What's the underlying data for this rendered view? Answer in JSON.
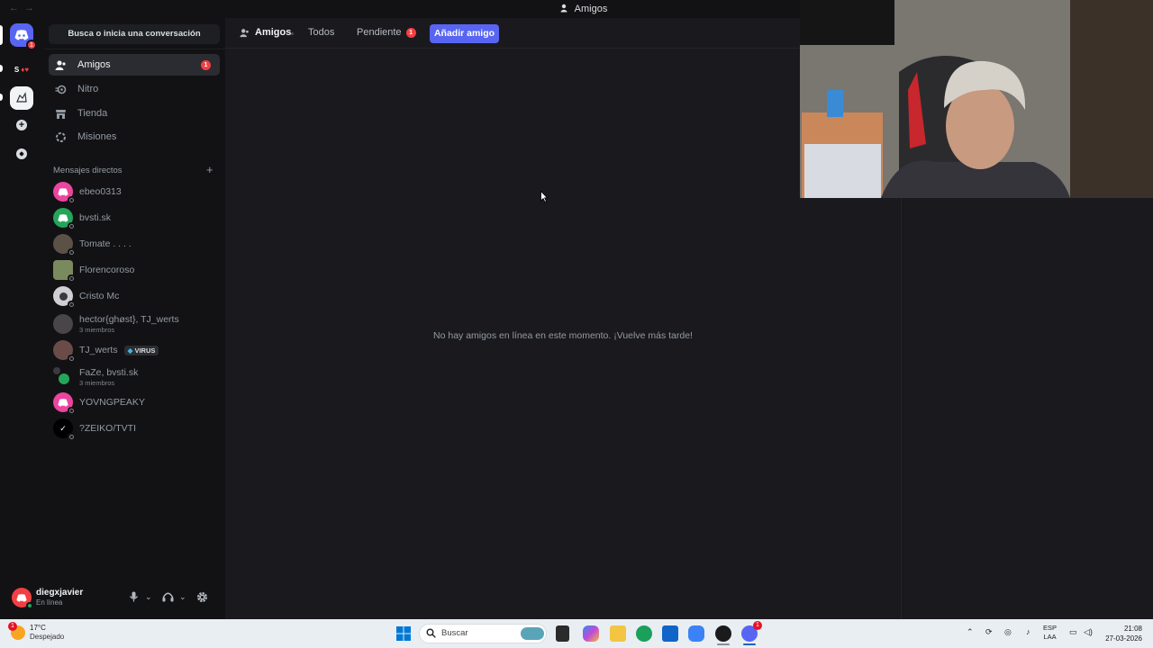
{
  "window": {
    "title": "Amigos"
  },
  "guilds": {
    "home_badge": "1",
    "server2_label": "S"
  },
  "sidebar": {
    "search_label": "Busca o inicia una conversación",
    "nav": [
      {
        "label": "Amigos",
        "badge": "1"
      },
      {
        "label": "Nitro"
      },
      {
        "label": "Tienda"
      },
      {
        "label": "Misiones"
      }
    ],
    "dm_header": "Mensajes directos",
    "dm_add": "+",
    "dms": [
      {
        "name": "ebeo0313"
      },
      {
        "name": "bvsti.sk"
      },
      {
        "name": "Tomate . . . ."
      },
      {
        "name": "Florencoroso"
      },
      {
        "name": "Cristo Mc"
      },
      {
        "name": "hector{ghøst}, TJ_werts",
        "sub": "3 miembros"
      },
      {
        "name": "TJ_werts",
        "tag": "VIRUS"
      },
      {
        "name": "FaZe, bvsti.sk",
        "sub": "3 miembros"
      },
      {
        "name": "YOVNGPEAKY"
      },
      {
        "name": "?ZEIKO/TVTI"
      }
    ]
  },
  "user": {
    "name": "diegxjavier",
    "status": "En línea"
  },
  "topbar": {
    "title": "Amigos",
    "tabs": [
      {
        "label": "Todos"
      },
      {
        "label": "Pendiente",
        "badge": "1"
      }
    ],
    "add_friend": "Añadir amigo"
  },
  "main": {
    "empty_text": "No hay amigos en línea en este momento. ¡Vuelve más tarde!"
  },
  "taskbar": {
    "weather_temp": "17°C",
    "weather_desc": "Despejado",
    "weather_badge": "1",
    "search_placeholder": "Buscar",
    "lang_top": "ESP",
    "lang_bottom": "LAA",
    "time": "21:08",
    "date": "27-03-2026",
    "discord_badge": "1"
  },
  "colors": {
    "accent": "#5865f2",
    "danger": "#f23f43",
    "online": "#23a55a",
    "background": "#121214"
  }
}
